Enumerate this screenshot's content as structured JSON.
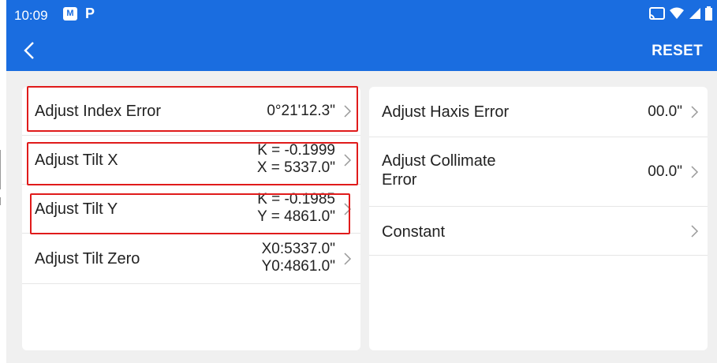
{
  "status": {
    "time": "10:09",
    "app_badge": "M",
    "app_letter": "P"
  },
  "toolbar": {
    "reset_label": "RESET"
  },
  "left_items": [
    {
      "label": "Adjust Index Error",
      "value_lines": [
        "0°21'12.3\""
      ]
    },
    {
      "label": "Adjust Tilt X",
      "value_lines": [
        "K = -0.1999",
        "X = 5337.0\""
      ]
    },
    {
      "label": "Adjust Tilt Y",
      "value_lines": [
        "K = -0.1985",
        "Y = 4861.0\""
      ]
    },
    {
      "label": "Adjust Tilt Zero",
      "value_lines": [
        "X0:5337.0\"",
        "Y0:4861.0\""
      ]
    }
  ],
  "right_items": [
    {
      "label": "Adjust Haxis Error",
      "value_lines": [
        "00.0\""
      ]
    },
    {
      "label_lines": [
        "Adjust Collimate",
        "Error"
      ],
      "value_lines": [
        "00.0\""
      ]
    },
    {
      "label": "Constant",
      "value_lines": []
    }
  ],
  "colors": {
    "primary": "#1a6de0",
    "highlight": "#e01b1b"
  }
}
